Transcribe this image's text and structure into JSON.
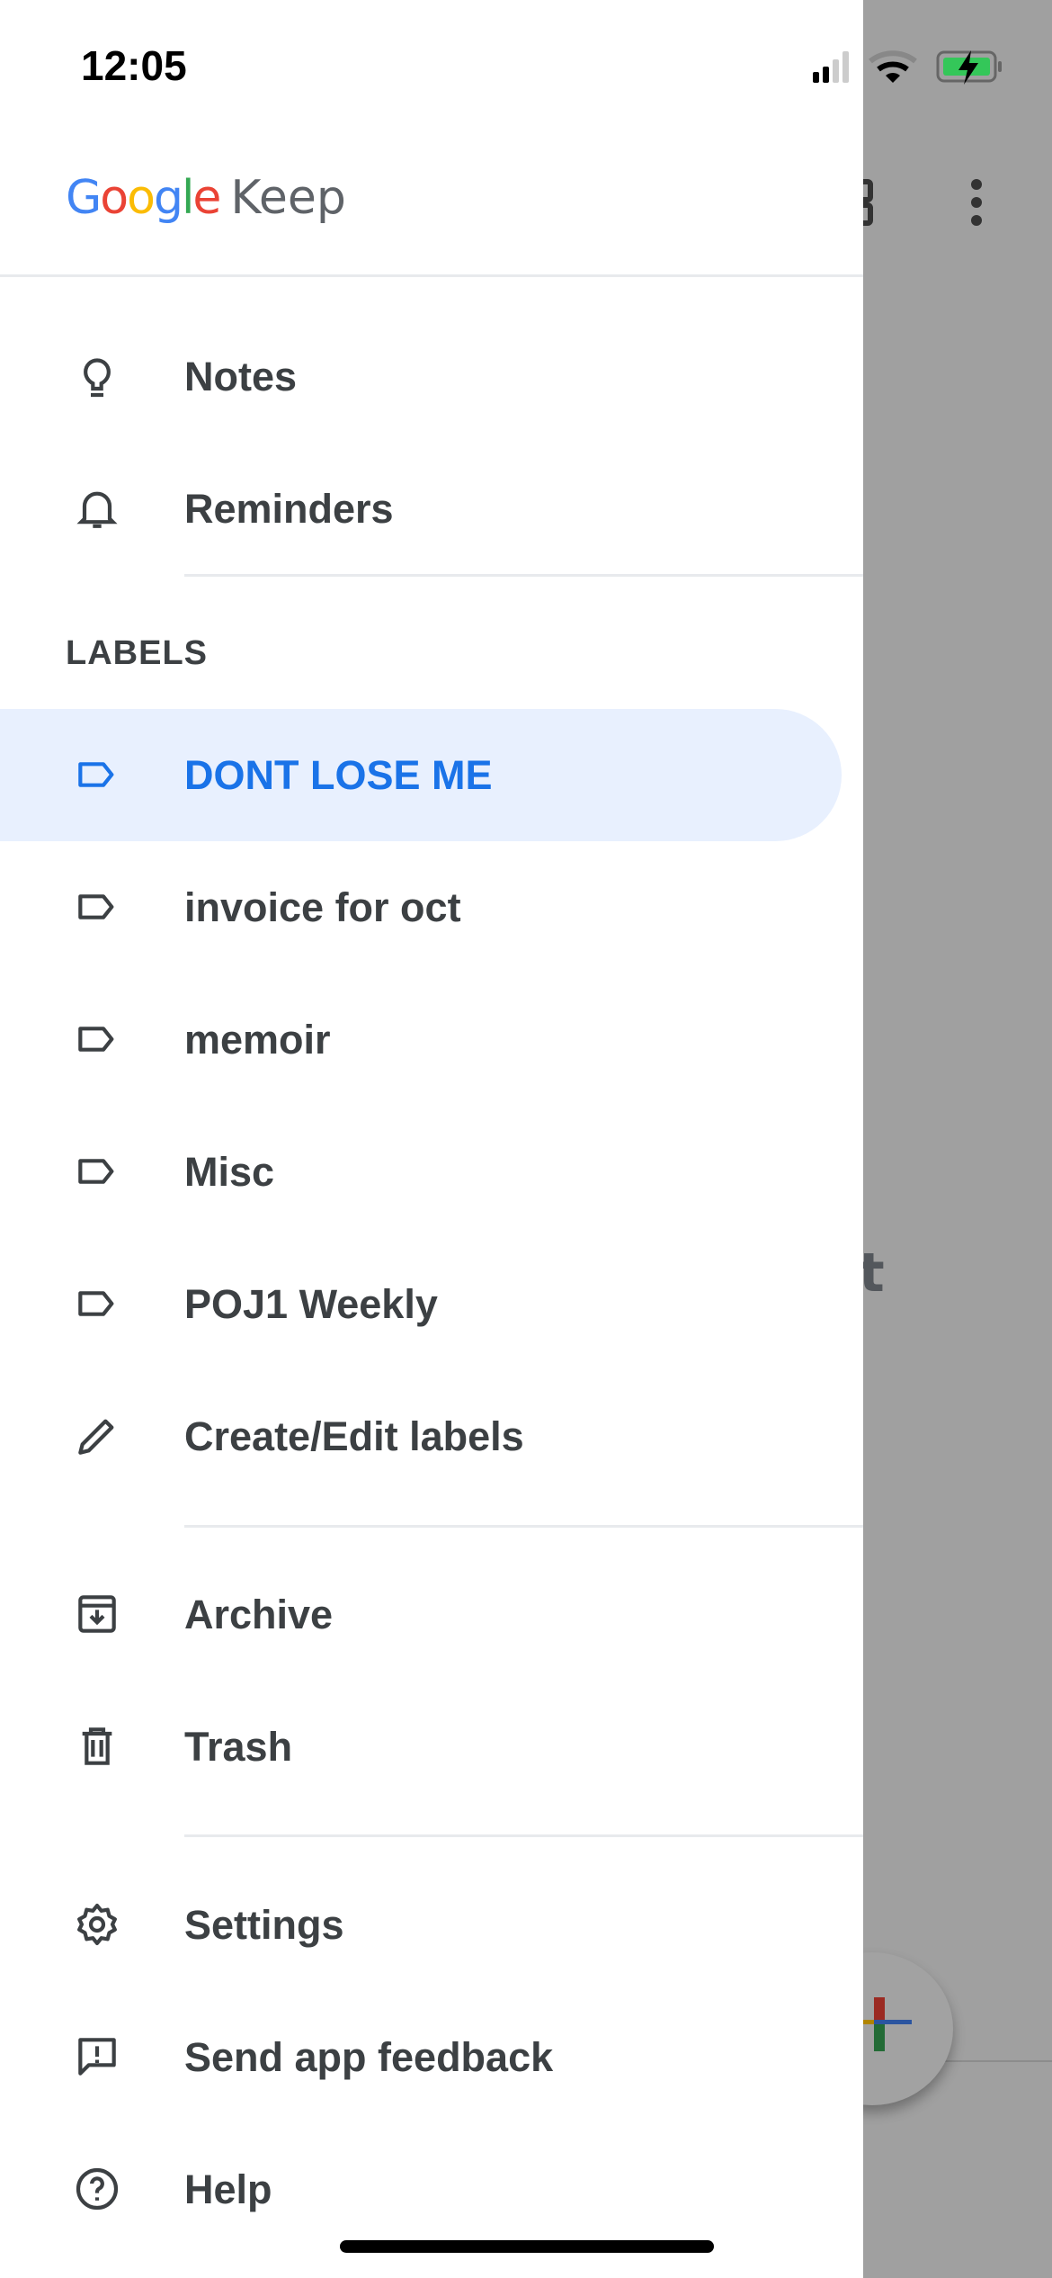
{
  "status_bar": {
    "time": "12:05"
  },
  "app": {
    "logo_google": "Google",
    "logo_keep": "Keep"
  },
  "background": {
    "partial_text": "t"
  },
  "nav": {
    "primary": [
      {
        "label": "Notes",
        "icon": "lightbulb-icon"
      },
      {
        "label": "Reminders",
        "icon": "bell-icon"
      }
    ],
    "labels_header": "LABELS",
    "labels": [
      {
        "label": "DONT LOSE ME",
        "selected": true
      },
      {
        "label": "invoice for oct"
      },
      {
        "label": "memoir"
      },
      {
        "label": "Misc"
      },
      {
        "label": "POJ1 Weekly"
      }
    ],
    "edit_labels": "Create/Edit labels",
    "secondary": [
      {
        "label": "Archive",
        "icon": "archive-icon"
      },
      {
        "label": "Trash",
        "icon": "trash-icon"
      }
    ],
    "tertiary": [
      {
        "label": "Settings",
        "icon": "gear-icon"
      },
      {
        "label": "Send app feedback",
        "icon": "feedback-icon"
      },
      {
        "label": "Help",
        "icon": "help-icon"
      }
    ]
  },
  "colors": {
    "accent": "#1a73e8",
    "selected_bg": "#e8f0fe",
    "text": "#3c4043",
    "scrim": "#a0a0a0"
  }
}
